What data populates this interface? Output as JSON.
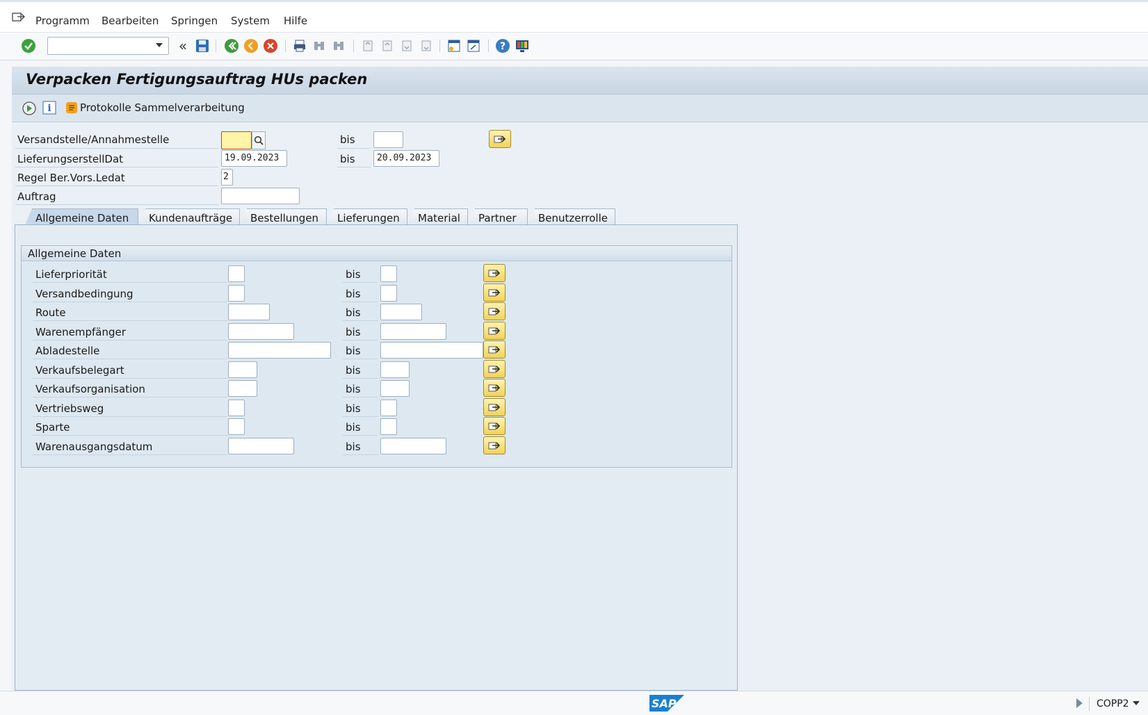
{
  "menu": [
    "Programm",
    "Bearbeiten",
    "Springen",
    "System",
    "Hilfe"
  ],
  "title": "Verpacken Fertigungsauftrag HUs packen",
  "app_toolbar": {
    "protocol_label": "Protokolle Sammelverarbeitung"
  },
  "header_fields": {
    "versandstelle": {
      "label": "Versandstelle/Annahmestelle",
      "from": "",
      "to": ""
    },
    "lieferdat": {
      "label": "LieferungserstellDat",
      "from": "19.09.2023",
      "to": "20.09.2023"
    },
    "regel": {
      "label": "Regel Ber.Vors.Ledat",
      "value": "2"
    },
    "auftrag": {
      "label": "Auftrag",
      "value": ""
    },
    "bis": "bis"
  },
  "tabs": [
    "Allgemeine Daten",
    "Kundenaufträge",
    "Bestellungen",
    "Lieferungen",
    "Material",
    "Partner",
    "Benutzerrolle"
  ],
  "group": {
    "title": "Allgemeine Daten",
    "rows": [
      {
        "label": "Lieferpriorität",
        "from": "",
        "to": ""
      },
      {
        "label": "Versandbedingung",
        "from": "",
        "to": ""
      },
      {
        "label": "Route",
        "from": "",
        "to": ""
      },
      {
        "label": "Warenempfänger",
        "from": "",
        "to": ""
      },
      {
        "label": "Abladestelle",
        "from": "",
        "to": ""
      },
      {
        "label": "Verkaufsbelegart",
        "from": "",
        "to": ""
      },
      {
        "label": "Verkaufsorganisation",
        "from": "",
        "to": ""
      },
      {
        "label": "Vertriebsweg",
        "from": "",
        "to": ""
      },
      {
        "label": "Sparte",
        "from": "",
        "to": ""
      },
      {
        "label": "Warenausgangsdatum",
        "from": "",
        "to": ""
      }
    ]
  },
  "status": {
    "system": "COPP2",
    "logo": "SAP"
  }
}
